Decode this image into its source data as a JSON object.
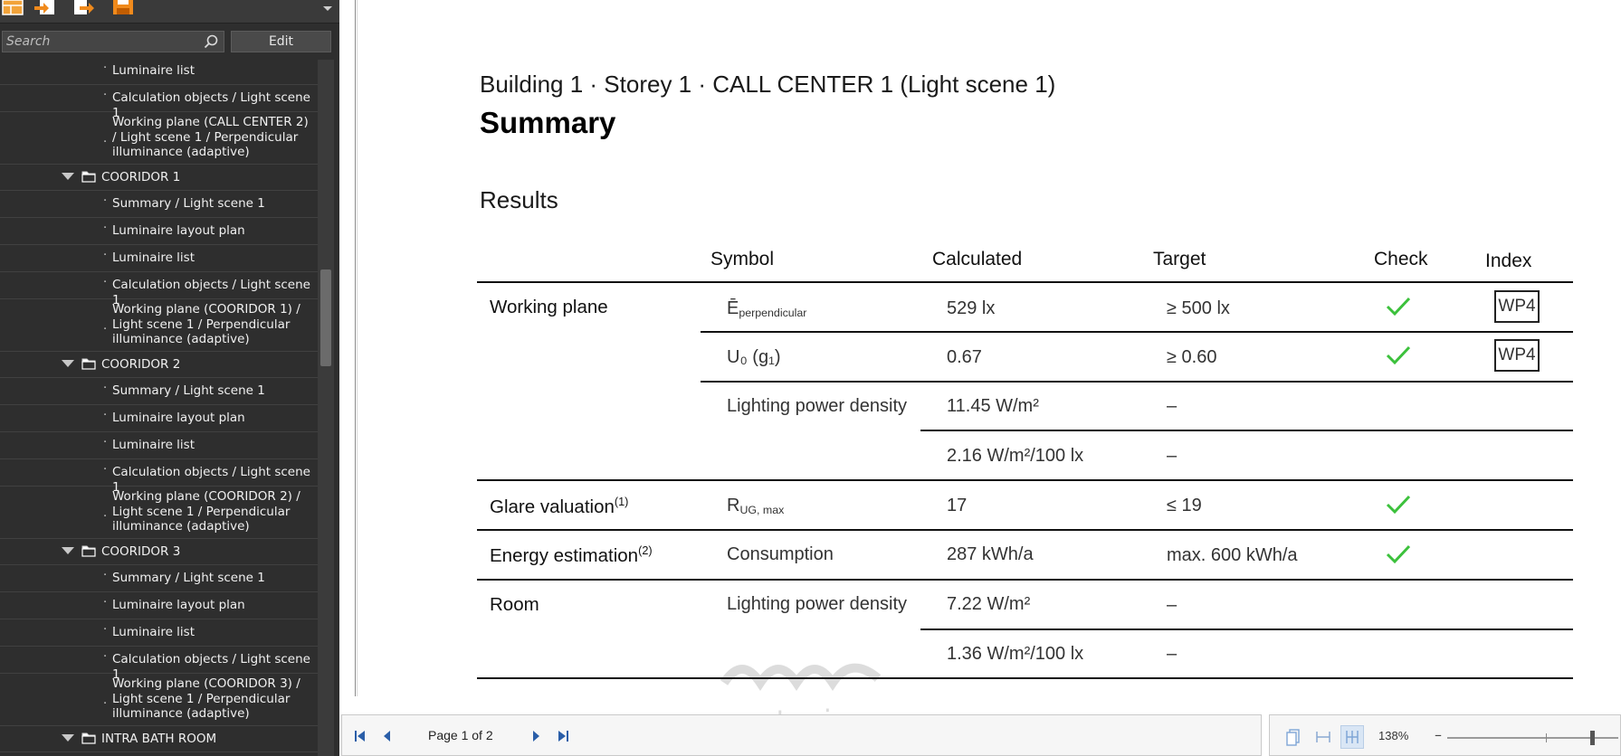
{
  "left_panel": {
    "search": {
      "placeholder": "Search"
    },
    "edit_label": "Edit",
    "tree": [
      {
        "type": "item",
        "label": "Luminaire list"
      },
      {
        "type": "item",
        "label": "Calculation objects / Light scene 1"
      },
      {
        "type": "item",
        "multi": true,
        "label": "Working plane (CALL CENTER 2) / Light scene 1 / Perpendicular illuminance (adaptive)"
      },
      {
        "type": "group",
        "label": "COORIDOR 1"
      },
      {
        "type": "item",
        "label": "Summary / Light scene 1"
      },
      {
        "type": "item",
        "label": "Luminaire layout plan"
      },
      {
        "type": "item",
        "label": "Luminaire list"
      },
      {
        "type": "item",
        "label": "Calculation objects / Light scene 1"
      },
      {
        "type": "item",
        "multi": true,
        "label": "Working plane (COORIDOR 1) / Light scene 1 / Perpendicular illuminance (adaptive)"
      },
      {
        "type": "group",
        "label": "COORIDOR 2"
      },
      {
        "type": "item",
        "label": "Summary / Light scene 1"
      },
      {
        "type": "item",
        "label": "Luminaire layout plan"
      },
      {
        "type": "item",
        "label": "Luminaire list"
      },
      {
        "type": "item",
        "label": "Calculation objects / Light scene 1"
      },
      {
        "type": "item",
        "multi": true,
        "label": "Working plane (COORIDOR 2) / Light scene 1 / Perpendicular illuminance (adaptive)"
      },
      {
        "type": "group",
        "label": "COORIDOR 3"
      },
      {
        "type": "item",
        "label": "Summary / Light scene 1"
      },
      {
        "type": "item",
        "label": "Luminaire layout plan"
      },
      {
        "type": "item",
        "label": "Luminaire list"
      },
      {
        "type": "item",
        "label": "Calculation objects / Light scene 1"
      },
      {
        "type": "item",
        "multi": true,
        "label": "Working plane (COORIDOR 3) / Light scene 1 / Perpendicular illuminance (adaptive)"
      },
      {
        "type": "group",
        "label": "INTRA BATH ROOM"
      }
    ]
  },
  "document": {
    "title": "Building 1 · Storey 1 · CALL CENTER 1 (Light scene 1)",
    "heading": "Summary",
    "section": "Results",
    "columns": {
      "symbol": "Symbol",
      "calculated": "Calculated",
      "target": "Target",
      "check": "Check",
      "index": "Index"
    },
    "rows": {
      "working_plane_label": "Working plane",
      "wp_sym1": "Ē",
      "wp_sym1_sub": "perpendicular",
      "wp_calc1": "529 lx",
      "wp_target1": "≥ 500 lx",
      "wp_index1": "WP4",
      "wp_sym2": "U₀ (g₁)",
      "wp_calc2": "0.67",
      "wp_target2": "≥ 0.60",
      "wp_index2": "WP4",
      "wp_sym3": "Lighting power density",
      "wp_calc3": "11.45 W/m²",
      "wp_target3": "–",
      "wp_calc4": "2.16 W/m²/100 lx",
      "wp_target4": "–",
      "glare_label": "Glare valuation",
      "glare_note": "(1)",
      "glare_sym": "R",
      "glare_sym_sub": "UG, max",
      "glare_calc": "17",
      "glare_target": "≤ 19",
      "energy_label": "Energy estimation",
      "energy_note": "(2)",
      "energy_sym": "Consumption",
      "energy_calc": "287 kWh/a",
      "energy_target": "max. 600 kWh/a",
      "room_label": "Room",
      "room_sym": "Lighting power density",
      "room_calc1": "7.22 W/m²",
      "room_target1": "–",
      "room_calc2": "1.36 W/m²/100 lx",
      "room_target2": "–"
    },
    "check_color": "#3cc13c"
  },
  "navigation": {
    "page_indicator": "Page 1 of 2"
  },
  "zoom": {
    "level": "138%"
  },
  "watermark": {
    "text": "mostaqi.com"
  }
}
